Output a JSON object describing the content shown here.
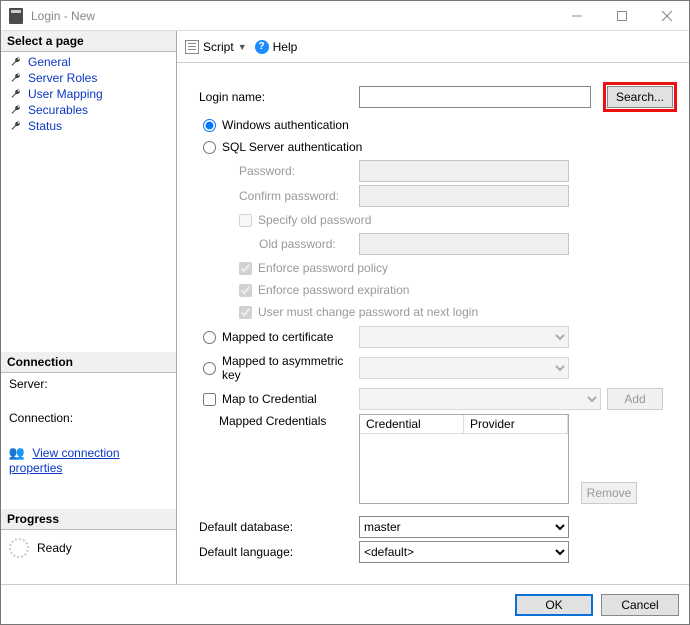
{
  "window": {
    "title": "Login - New"
  },
  "sidebar": {
    "select_page": "Select a page",
    "pages": [
      "General",
      "Server Roles",
      "User Mapping",
      "Securables",
      "Status"
    ],
    "connection_hdr": "Connection",
    "server_lbl": "Server:",
    "connection_lbl": "Connection:",
    "view_conn_props": "View connection properties",
    "progress_hdr": "Progress",
    "progress_status": "Ready"
  },
  "toolbar": {
    "script": "Script",
    "help": "Help"
  },
  "form": {
    "login_name": "Login name:",
    "search": "Search...",
    "windows_auth": "Windows authentication",
    "sql_auth": "SQL Server authentication",
    "password": "Password:",
    "confirm_password": "Confirm password:",
    "specify_old": "Specify old password",
    "old_password": "Old password:",
    "enforce_policy": "Enforce password policy",
    "enforce_expiration": "Enforce password expiration",
    "must_change": "User must change password at next login",
    "mapped_cert": "Mapped to certificate",
    "mapped_asym": "Mapped to asymmetric key",
    "map_cred": "Map to Credential",
    "add": "Add",
    "mapped_creds": "Mapped Credentials",
    "col_credential": "Credential",
    "col_provider": "Provider",
    "remove": "Remove",
    "default_db": "Default database:",
    "default_db_val": "master",
    "default_lang": "Default language:",
    "default_lang_val": "<default>"
  },
  "footer": {
    "ok": "OK",
    "cancel": "Cancel"
  }
}
